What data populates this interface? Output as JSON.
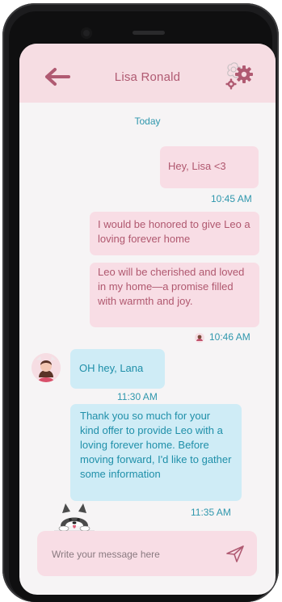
{
  "header": {
    "title": "Lisa Ronald",
    "back_icon": "arrow-left-icon",
    "settings_icon": "gear-icon"
  },
  "chat": {
    "date_label": "Today",
    "outgoing": [
      {
        "text": "Hey, Lisa <3"
      },
      {
        "text": "I would be honored to give Leo a loving forever home"
      },
      {
        "text": "Leo will be cherished and loved in my home—a promise filled with warmth and joy."
      }
    ],
    "outgoing_times": [
      "10:45 AM",
      "10:46 AM"
    ],
    "incoming": [
      {
        "text": "OH hey, Lana"
      },
      {
        "text": "Thank you so much for your kind offer to provide Leo with a loving forever home. Before moving forward, I'd like to gather some information"
      }
    ],
    "incoming_times": [
      "11:30 AM",
      "11:35 AM"
    ]
  },
  "composer": {
    "placeholder": "Write your message here",
    "send_icon": "send-icon"
  },
  "colors": {
    "accent_pink": "#b05a72",
    "header_bg": "#f6dde3",
    "teal": "#2f97ad",
    "incoming_bg": "#cfecf6",
    "outgoing_bg": "#f8dde5"
  }
}
